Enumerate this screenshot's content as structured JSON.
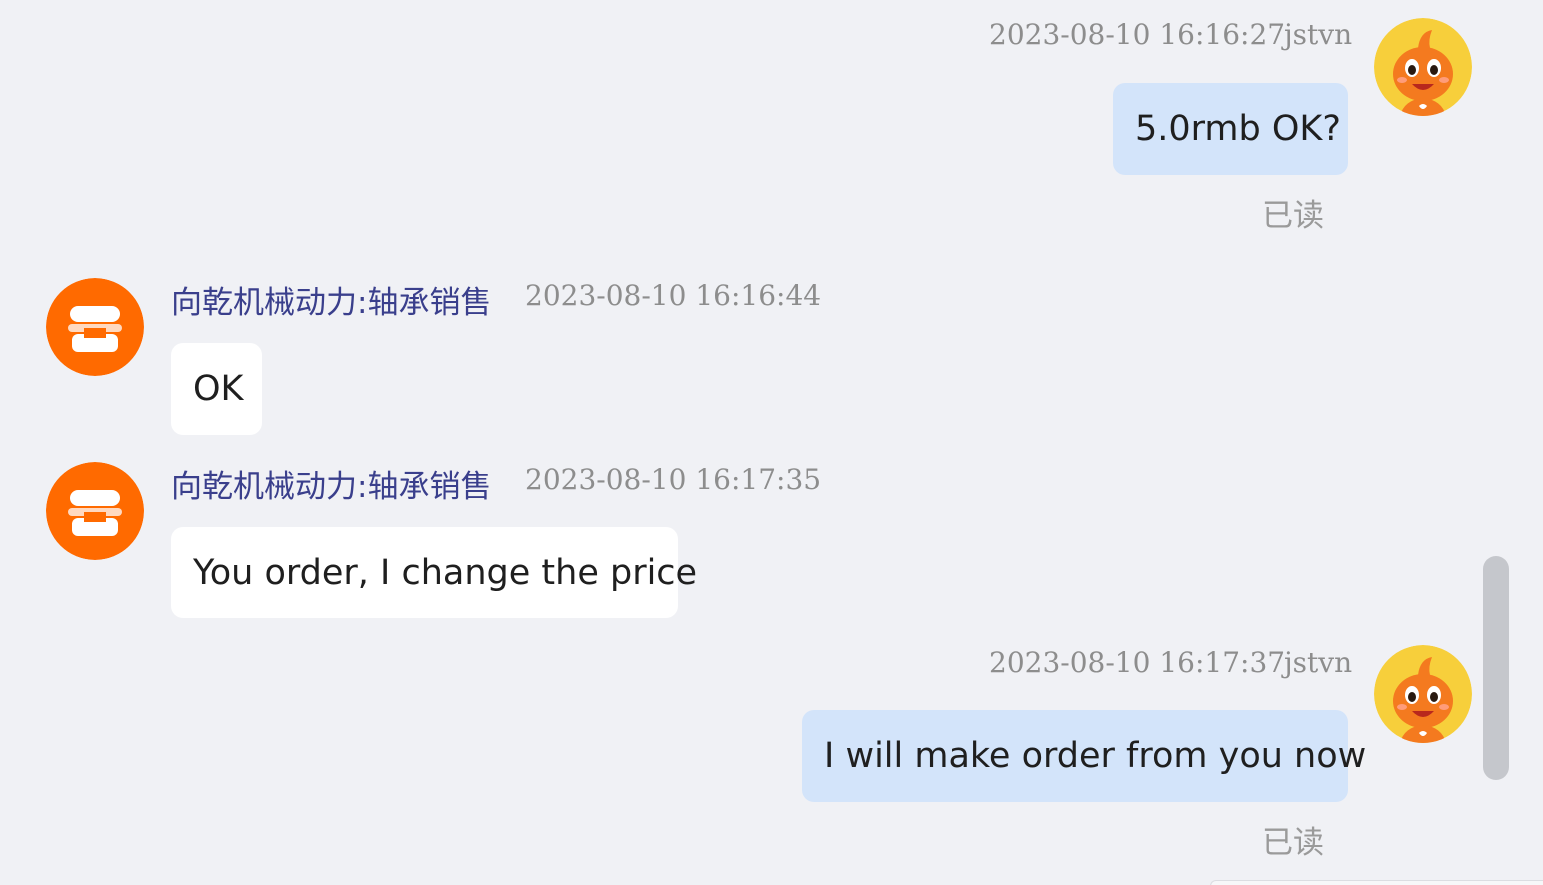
{
  "messages": [
    {
      "direction": "out",
      "time": "2023-08-10 16:16:27",
      "user": "jstvn",
      "text": "5.0rmb OK?",
      "status": "已读"
    },
    {
      "direction": "in",
      "sender": "向乾机械动力:轴承销售",
      "time": "2023-08-10 16:16:44",
      "text": "OK"
    },
    {
      "direction": "in",
      "sender": "向乾机械动力:轴承销售",
      "time": "2023-08-10 16:17:35",
      "text": "You order, I change the price"
    },
    {
      "direction": "out",
      "time": "2023-08-10 16:17:37",
      "user": "jstvn",
      "text": "I will make order from you now",
      "status": "已读"
    }
  ],
  "icons": {
    "user_avatar": "orange-mascot-avatar-icon",
    "shop_avatar": "shop-store-icon"
  },
  "colors": {
    "background": "#f0f1f5",
    "outgoing_bubble": "#d3e4fa",
    "incoming_bubble": "#ffffff",
    "sender_name": "#3a3f8c",
    "shop_avatar": "#ff6a00",
    "user_avatar_ring": "#f7cf3b"
  }
}
